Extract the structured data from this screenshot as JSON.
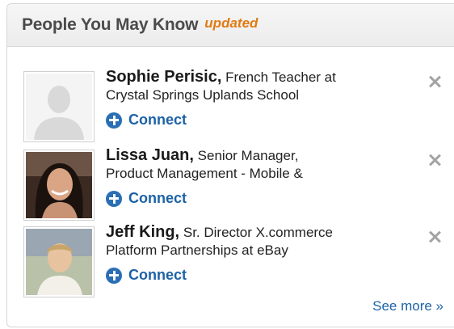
{
  "widget": {
    "title": "People You May Know",
    "badge": "updated",
    "connect_label": "Connect",
    "see_more": "See more »"
  },
  "people": [
    {
      "name": "Sophie Perisic,",
      "headline_1": "French Teacher at",
      "headline_2": "Crystal Springs Uplands School",
      "photo": "default-silhouette"
    },
    {
      "name": "Lissa Juan,",
      "headline_1": "Senior Manager,",
      "headline_2": "Product Management - Mobile &",
      "photo": "profile-photo"
    },
    {
      "name": "Jeff King,",
      "headline_1": "Sr. Director X.commerce",
      "headline_2": "Platform Partnerships at eBay",
      "photo": "profile-photo"
    }
  ],
  "colors": {
    "accent_link": "#1d62a6",
    "badge": "#e07b12",
    "connect_icon": "#2a6fb5"
  }
}
